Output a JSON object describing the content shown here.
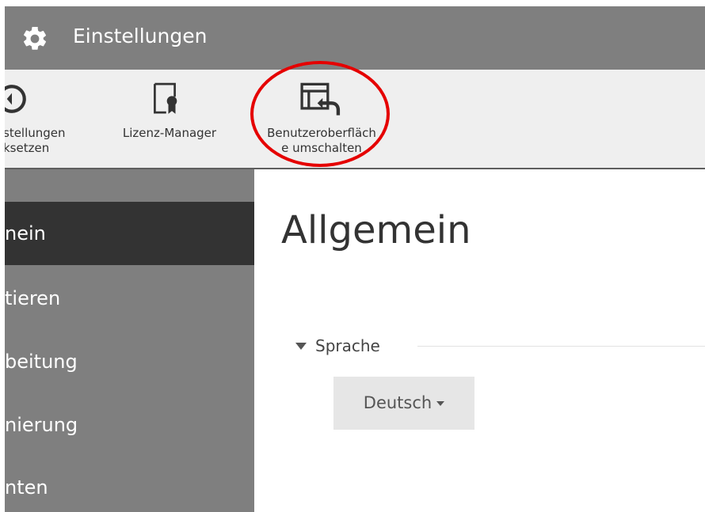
{
  "titlebar": {
    "title": "Einstellungen",
    "icon": "gear-icon"
  },
  "toolbar": {
    "buttons": [
      {
        "label_line1": "stellungen",
        "label_line2": "ksetzen",
        "icon": "reset-icon"
      },
      {
        "label_line1": "Lizenz-Manager",
        "label_line2": "",
        "icon": "license-icon"
      },
      {
        "label_line1": "Benutzeroberfläch",
        "label_line2": "e umschalten",
        "icon": "switch-ui-icon"
      }
    ]
  },
  "sidebar": {
    "items": [
      {
        "label": "nein",
        "active": true
      },
      {
        "label": "tieren",
        "active": false
      },
      {
        "label": "beitung",
        "active": false
      },
      {
        "label": "nierung",
        "active": false
      },
      {
        "label": "nten",
        "active": false
      }
    ]
  },
  "main": {
    "title": "Allgemein",
    "section": {
      "title": "Sprache",
      "language_value": "Deutsch"
    }
  },
  "colors": {
    "titlebar": "#7f7f7f",
    "toolbar": "#efefef",
    "sidebar": "#7f7f7f",
    "sidebar_active": "#333333",
    "annotation": "#e50000"
  }
}
